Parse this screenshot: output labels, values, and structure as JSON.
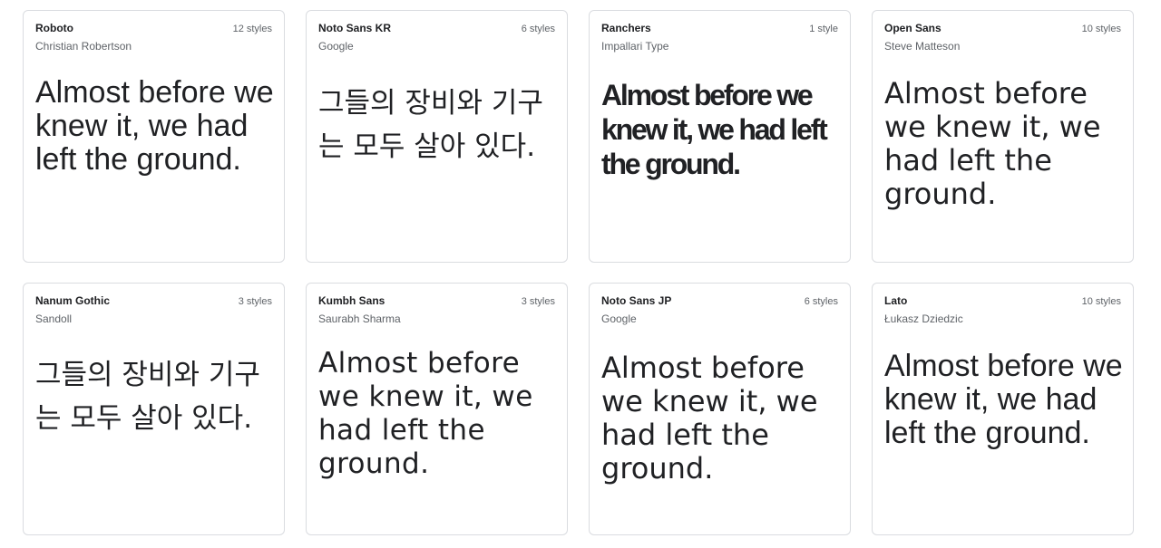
{
  "cards": [
    {
      "family": "Roboto",
      "styles": "12 styles",
      "designer": "Christian Robertson",
      "sample": "Almost before we knew it, we had left the ground."
    },
    {
      "family": "Noto Sans KR",
      "styles": "6 styles",
      "designer": "Google",
      "sample": "그들의 장비와 기구는 모두 살아 있다."
    },
    {
      "family": "Ranchers",
      "styles": "1 style",
      "designer": "Impallari Type",
      "sample": "Almost before we knew it, we had left the ground."
    },
    {
      "family": "Open Sans",
      "styles": "10 styles",
      "designer": "Steve Matteson",
      "sample": "Almost before we knew it, we had left the ground."
    },
    {
      "family": "Nanum Gothic",
      "styles": "3 styles",
      "designer": "Sandoll",
      "sample": "그들의 장비와 기구는 모두 살아 있다."
    },
    {
      "family": "Kumbh Sans",
      "styles": "3 styles",
      "designer": "Saurabh Sharma",
      "sample": "Almost before we knew it, we had left the ground."
    },
    {
      "family": "Noto Sans JP",
      "styles": "6 styles",
      "designer": "Google",
      "sample": "Almost before we knew it, we had left the ground."
    },
    {
      "family": "Lato",
      "styles": "10 styles",
      "designer": "Łukasz Dziedzic",
      "sample": "Almost before we knew it, we had left the ground."
    }
  ]
}
